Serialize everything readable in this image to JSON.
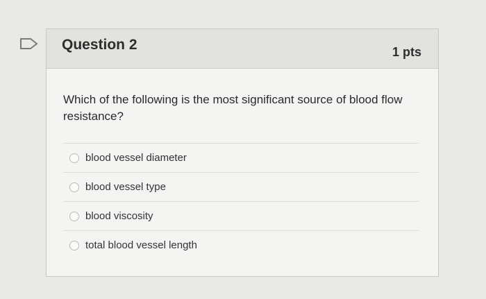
{
  "question": {
    "title": "Question 2",
    "points": "1 pts",
    "text": "Which of the following is the most significant source of blood flow resistance?",
    "answers": [
      {
        "label": "blood vessel diameter"
      },
      {
        "label": "blood vessel type"
      },
      {
        "label": "blood viscosity"
      },
      {
        "label": "total blood vessel length"
      }
    ]
  },
  "icons": {
    "flag": "flag-icon",
    "radio": "radio-button-icon"
  }
}
